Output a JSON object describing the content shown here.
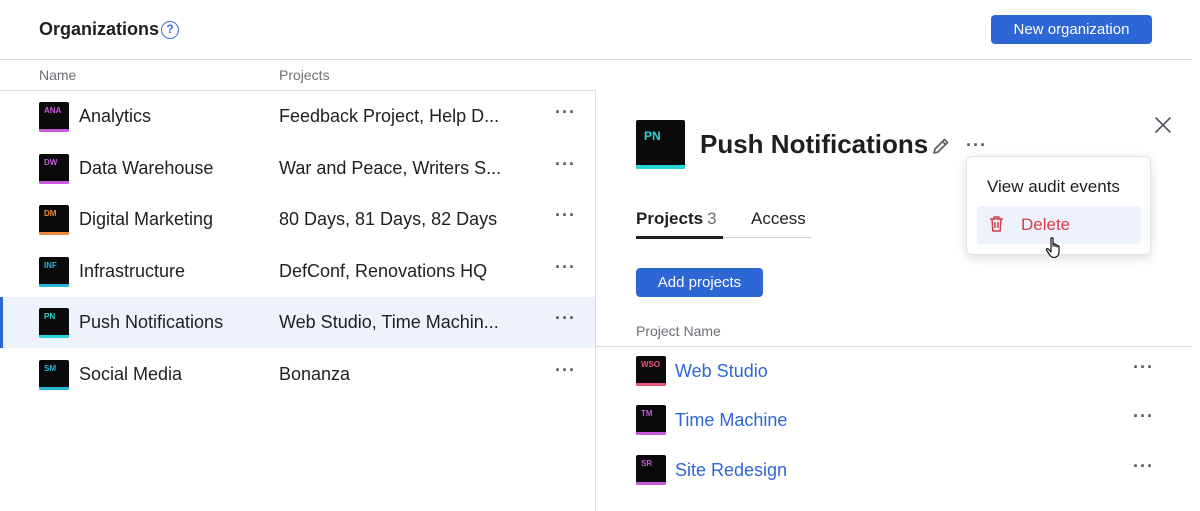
{
  "header": {
    "title": "Organizations",
    "help_icon": "help-circle-icon",
    "new_button": "New organization"
  },
  "org_list": {
    "columns": [
      "Name",
      "Projects"
    ],
    "rows": [
      {
        "initials": "ANA",
        "name": "Analytics",
        "projects": "Feedback Project, Help D...",
        "accent": "#c75bdc",
        "selected": false
      },
      {
        "initials": "DW",
        "name": "Data Warehouse",
        "projects": "War and Peace, Writers S...",
        "accent": "#c75bdc",
        "selected": false
      },
      {
        "initials": "DM",
        "name": "Digital Marketing",
        "projects": "80 Days, 81 Days, 82 Days",
        "accent": "#f08a3c",
        "selected": false
      },
      {
        "initials": "INF",
        "name": "Infrastructure",
        "projects": "DefConf, Renovations HQ",
        "accent": "#27b7d9",
        "selected": false
      },
      {
        "initials": "PN",
        "name": "Push Notifications",
        "projects": "Web Studio, Time Machin...",
        "accent": "#27d6d6",
        "selected": true
      },
      {
        "initials": "SM",
        "name": "Social Media",
        "projects": "Bonanza",
        "accent": "#27b7d9",
        "selected": false
      }
    ],
    "more_icon": "more-horizontal-icon"
  },
  "detail": {
    "initials": "PN",
    "title": "Push Notifications",
    "edit_icon": "pencil-icon",
    "more_icon": "more-horizontal-icon",
    "close_icon": "close-icon",
    "tabs": [
      {
        "label": "Projects",
        "count": "3",
        "active": true
      },
      {
        "label": "Access",
        "active": false
      }
    ],
    "add_button": "Add projects",
    "projects_column": "Project Name",
    "projects": [
      {
        "initials": "WSO",
        "name": "Web Studio",
        "accent": "#e8577a"
      },
      {
        "initials": "TM",
        "name": "Time Machine",
        "accent": "#c75bdc"
      },
      {
        "initials": "SR",
        "name": "Site Redesign",
        "accent": "#c75bdc"
      }
    ]
  },
  "menu": {
    "items": [
      {
        "label": "View audit events"
      },
      {
        "label": "Delete",
        "icon": "trash-icon",
        "hovered": true,
        "color": "#d1404a"
      }
    ]
  },
  "colors": {
    "primary": "#2d67d6",
    "selected_bg": "#edf2fd",
    "danger": "#d1404a"
  }
}
